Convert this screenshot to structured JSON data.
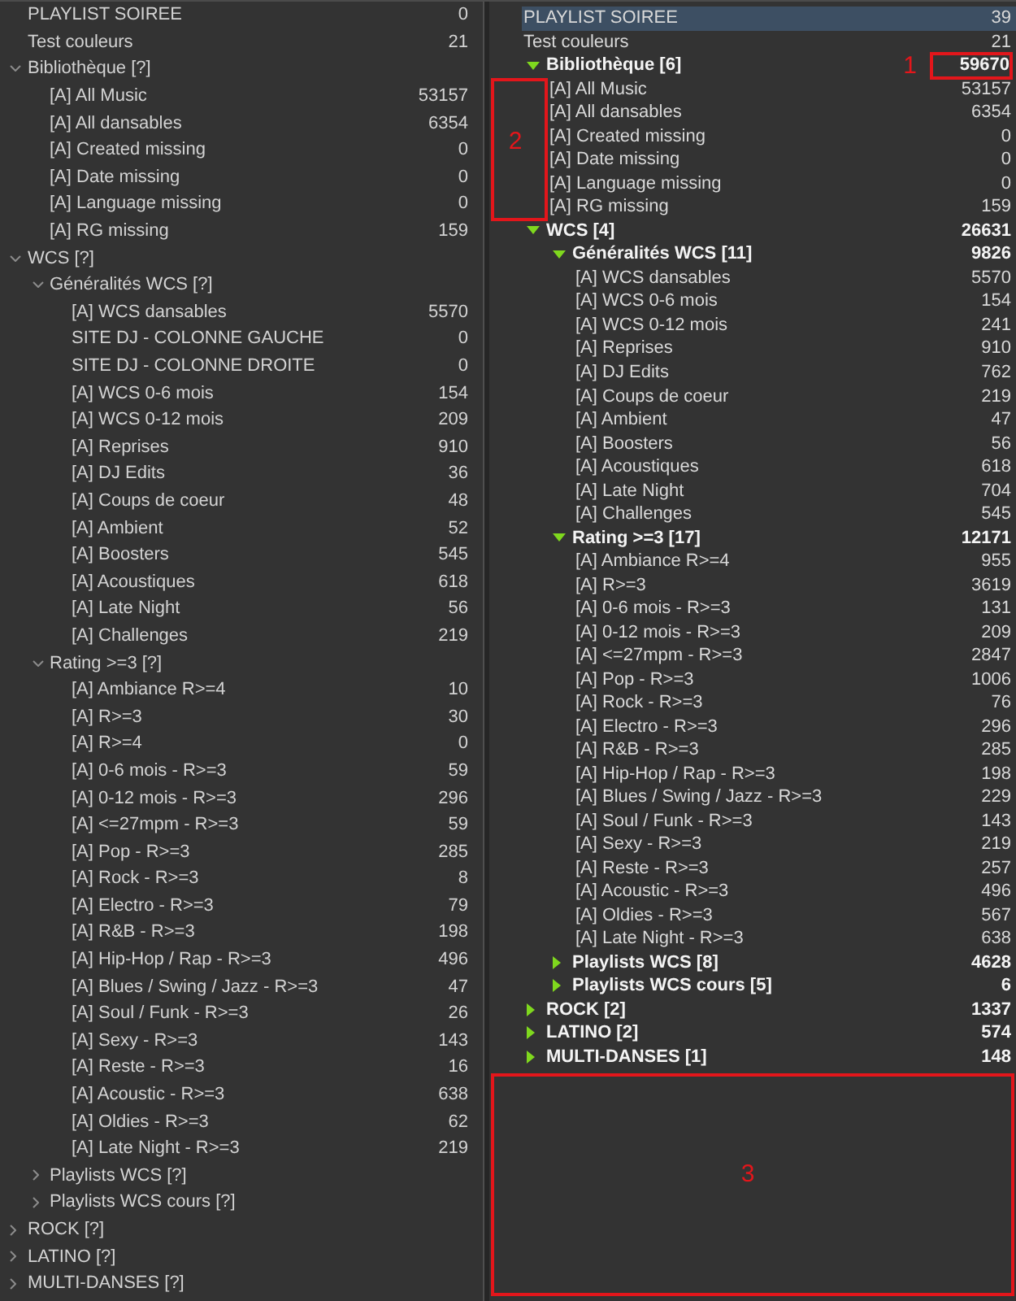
{
  "left_tree": {
    "items": [
      {
        "label": "PLAYLIST SOIREE",
        "count": "0",
        "kind": "playlist"
      },
      {
        "label": "Test couleurs",
        "count": "21",
        "kind": "playlist"
      },
      {
        "label": "Bibliothèque [?]",
        "kind": "folder",
        "expanded": true,
        "children": [
          {
            "label": "[A] All Music",
            "count": "53157",
            "kind": "playlist"
          },
          {
            "label": "[A] All dansables",
            "count": "6354",
            "kind": "playlist"
          },
          {
            "label": "[A] Created missing",
            "count": "0",
            "kind": "playlist"
          },
          {
            "label": "[A] Date missing",
            "count": "0",
            "kind": "playlist"
          },
          {
            "label": "[A] Language missing",
            "count": "0",
            "kind": "playlist"
          },
          {
            "label": "[A] RG missing",
            "count": "159",
            "kind": "playlist"
          }
        ]
      },
      {
        "label": "WCS [?]",
        "kind": "folder",
        "expanded": true,
        "children": [
          {
            "label": "Généralités WCS [?]",
            "kind": "folder",
            "expanded": true,
            "children": [
              {
                "label": "[A] WCS dansables",
                "count": "5570",
                "kind": "playlist"
              },
              {
                "label": "SITE DJ - COLONNE GAUCHE",
                "count": "0",
                "kind": "playlist"
              },
              {
                "label": "SITE DJ - COLONNE DROITE",
                "count": "0",
                "kind": "playlist"
              },
              {
                "label": "[A] WCS 0-6 mois",
                "count": "154",
                "kind": "playlist"
              },
              {
                "label": "[A] WCS 0-12 mois",
                "count": "209",
                "kind": "playlist"
              },
              {
                "label": "[A] Reprises",
                "count": "910",
                "kind": "playlist"
              },
              {
                "label": "[A] DJ Edits",
                "count": "36",
                "kind": "playlist"
              },
              {
                "label": "[A] Coups de coeur",
                "count": "48",
                "kind": "playlist"
              },
              {
                "label": "[A] Ambient",
                "count": "52",
                "kind": "playlist"
              },
              {
                "label": "[A] Boosters",
                "count": "545",
                "kind": "playlist"
              },
              {
                "label": "[A] Acoustiques",
                "count": "618",
                "kind": "playlist"
              },
              {
                "label": "[A] Late Night",
                "count": "56",
                "kind": "playlist"
              },
              {
                "label": "[A] Challenges",
                "count": "219",
                "kind": "playlist"
              }
            ]
          },
          {
            "label": "Rating >=3 [?]",
            "kind": "folder",
            "expanded": true,
            "children": [
              {
                "label": "[A] Ambiance R>=4",
                "count": "10",
                "kind": "playlist"
              },
              {
                "label": "[A] R>=3",
                "count": "30",
                "kind": "playlist"
              },
              {
                "label": "[A] R>=4",
                "count": "0",
                "kind": "playlist"
              },
              {
                "label": "[A] 0-6 mois - R>=3",
                "count": "59",
                "kind": "playlist"
              },
              {
                "label": "[A] 0-12 mois - R>=3",
                "count": "296",
                "kind": "playlist"
              },
              {
                "label": "[A] <=27mpm - R>=3",
                "count": "59",
                "kind": "playlist"
              },
              {
                "label": "[A] Pop - R>=3",
                "count": "285",
                "kind": "playlist"
              },
              {
                "label": "[A] Rock - R>=3",
                "count": "8",
                "kind": "playlist"
              },
              {
                "label": "[A] Electro - R>=3",
                "count": "79",
                "kind": "playlist"
              },
              {
                "label": "[A] R&B - R>=3",
                "count": "198",
                "kind": "playlist"
              },
              {
                "label": "[A] Hip-Hop / Rap - R>=3",
                "count": "496",
                "kind": "playlist"
              },
              {
                "label": "[A] Blues / Swing / Jazz - R>=3",
                "count": "47",
                "kind": "playlist"
              },
              {
                "label": "[A] Soul / Funk - R>=3",
                "count": "26",
                "kind": "playlist"
              },
              {
                "label": "[A] Sexy - R>=3",
                "count": "143",
                "kind": "playlist"
              },
              {
                "label": "[A] Reste - R>=3",
                "count": "16",
                "kind": "playlist"
              },
              {
                "label": "[A] Acoustic - R>=3",
                "count": "638",
                "kind": "playlist"
              },
              {
                "label": "[A] Oldies - R>=3",
                "count": "62",
                "kind": "playlist"
              },
              {
                "label": "[A] Late Night - R>=3",
                "count": "219",
                "kind": "playlist"
              }
            ]
          },
          {
            "label": "Playlists WCS [?]",
            "kind": "folder",
            "expanded": false
          },
          {
            "label": "Playlists WCS cours [?]",
            "kind": "folder",
            "expanded": false
          }
        ]
      },
      {
        "label": "ROCK [?]",
        "kind": "folder",
        "expanded": false
      },
      {
        "label": "LATINO [?]",
        "kind": "folder",
        "expanded": false
      },
      {
        "label": "MULTI-DANSES [?]",
        "kind": "folder",
        "expanded": false
      }
    ]
  },
  "right_tree": {
    "items": [
      {
        "label": "PLAYLIST SOIREE",
        "count": "39",
        "kind": "playlist",
        "selected": true
      },
      {
        "label": "Test couleurs",
        "count": "21",
        "kind": "playlist",
        "selected": false
      },
      {
        "label": "Bibliothèque [6]",
        "count": "59670",
        "annotation": "1",
        "kind": "folder",
        "expanded": true,
        "selected": false,
        "children": [
          {
            "label": "[A] All Music",
            "count": "53157",
            "kind": "playlist",
            "selected": false
          },
          {
            "label": "[A] All dansables",
            "count": "6354",
            "kind": "playlist",
            "selected": false
          },
          {
            "label": "[A] Created missing",
            "count": "0",
            "kind": "playlist",
            "selected": false
          },
          {
            "label": "[A] Date missing",
            "count": "0",
            "kind": "playlist",
            "selected": false
          },
          {
            "label": "[A] Language missing",
            "count": "0",
            "kind": "playlist",
            "selected": false
          },
          {
            "label": "[A] RG missing",
            "count": "159",
            "kind": "playlist",
            "selected": false
          }
        ]
      },
      {
        "label": "WCS [4]",
        "count": "26631",
        "kind": "folder",
        "expanded": true,
        "selected": false,
        "children": [
          {
            "label": "Généralités WCS [11]",
            "count": "9826",
            "kind": "folder",
            "expanded": true,
            "selected": false,
            "children": [
              {
                "label": "[A] WCS dansables",
                "count": "5570",
                "kind": "playlist",
                "selected": false
              },
              {
                "label": "[A] WCS 0-6 mois",
                "count": "154",
                "kind": "playlist",
                "selected": false
              },
              {
                "label": "[A] WCS 0-12 mois",
                "count": "241",
                "kind": "playlist",
                "selected": false
              },
              {
                "label": "[A] Reprises",
                "count": "910",
                "kind": "playlist",
                "selected": false
              },
              {
                "label": "[A] DJ Edits",
                "count": "762",
                "kind": "playlist",
                "selected": false
              },
              {
                "label": "[A] Coups de coeur",
                "count": "219",
                "kind": "playlist",
                "selected": false
              },
              {
                "label": "[A] Ambient",
                "count": "47",
                "kind": "playlist",
                "selected": false
              },
              {
                "label": "[A] Boosters",
                "count": "56",
                "kind": "playlist",
                "selected": false
              },
              {
                "label": "[A] Acoustiques",
                "count": "618",
                "kind": "playlist",
                "selected": false
              },
              {
                "label": "[A] Late Night",
                "count": "704",
                "kind": "playlist",
                "selected": false
              },
              {
                "label": "[A] Challenges",
                "count": "545",
                "kind": "playlist",
                "selected": false
              }
            ]
          },
          {
            "label": "Rating >=3 [17]",
            "count": "12171",
            "kind": "folder",
            "expanded": true,
            "selected": false,
            "children": [
              {
                "label": "[A] Ambiance R>=4",
                "count": "955",
                "kind": "playlist",
                "selected": false
              },
              {
                "label": "[A] R>=3",
                "count": "3619",
                "kind": "playlist",
                "selected": false
              },
              {
                "label": "[A] 0-6 mois - R>=3",
                "count": "131",
                "kind": "playlist",
                "selected": false
              },
              {
                "label": "[A] 0-12 mois - R>=3",
                "count": "209",
                "kind": "playlist",
                "selected": false
              },
              {
                "label": "[A] <=27mpm - R>=3",
                "count": "2847",
                "kind": "playlist",
                "selected": false
              },
              {
                "label": "[A] Pop - R>=3",
                "count": "1006",
                "kind": "playlist",
                "selected": false
              },
              {
                "label": "[A] Rock - R>=3",
                "count": "76",
                "kind": "playlist",
                "selected": false
              },
              {
                "label": "[A] Electro - R>=3",
                "count": "296",
                "kind": "playlist",
                "selected": false
              },
              {
                "label": "[A] R&B - R>=3",
                "count": "285",
                "kind": "playlist",
                "selected": false
              },
              {
                "label": "[A] Hip-Hop / Rap - R>=3",
                "count": "198",
                "kind": "playlist",
                "selected": false
              },
              {
                "label": "[A] Blues / Swing / Jazz - R>=3",
                "count": "229",
                "kind": "playlist",
                "selected": false
              },
              {
                "label": "[A] Soul / Funk - R>=3",
                "count": "143",
                "kind": "playlist",
                "selected": false
              },
              {
                "label": "[A] Sexy - R>=3",
                "count": "219",
                "kind": "playlist",
                "selected": false
              },
              {
                "label": "[A] Reste - R>=3",
                "count": "257",
                "kind": "playlist",
                "selected": false
              },
              {
                "label": "[A] Acoustic - R>=3",
                "count": "496",
                "kind": "playlist",
                "selected": false
              },
              {
                "label": "[A] Oldies - R>=3",
                "count": "567",
                "kind": "playlist",
                "selected": false
              },
              {
                "label": "[A] Late Night - R>=3",
                "count": "638",
                "kind": "playlist",
                "selected": false
              }
            ]
          },
          {
            "label": "Playlists WCS [8]",
            "count": "4628",
            "kind": "folder",
            "expanded": false,
            "selected": false
          },
          {
            "label": "Playlists WCS cours [5]",
            "count": "6",
            "kind": "folder",
            "expanded": false,
            "selected": false
          }
        ]
      },
      {
        "label": "ROCK [2]",
        "count": "1337",
        "kind": "folder",
        "expanded": false,
        "selected": false
      },
      {
        "label": "LATINO [2]",
        "count": "574",
        "kind": "folder",
        "expanded": false,
        "selected": false
      },
      {
        "label": "MULTI-DANSES [1]",
        "count": "148",
        "kind": "folder",
        "expanded": false,
        "selected": false
      }
    ]
  },
  "annotations": [
    {
      "label": "2"
    },
    {
      "label": "3"
    }
  ]
}
